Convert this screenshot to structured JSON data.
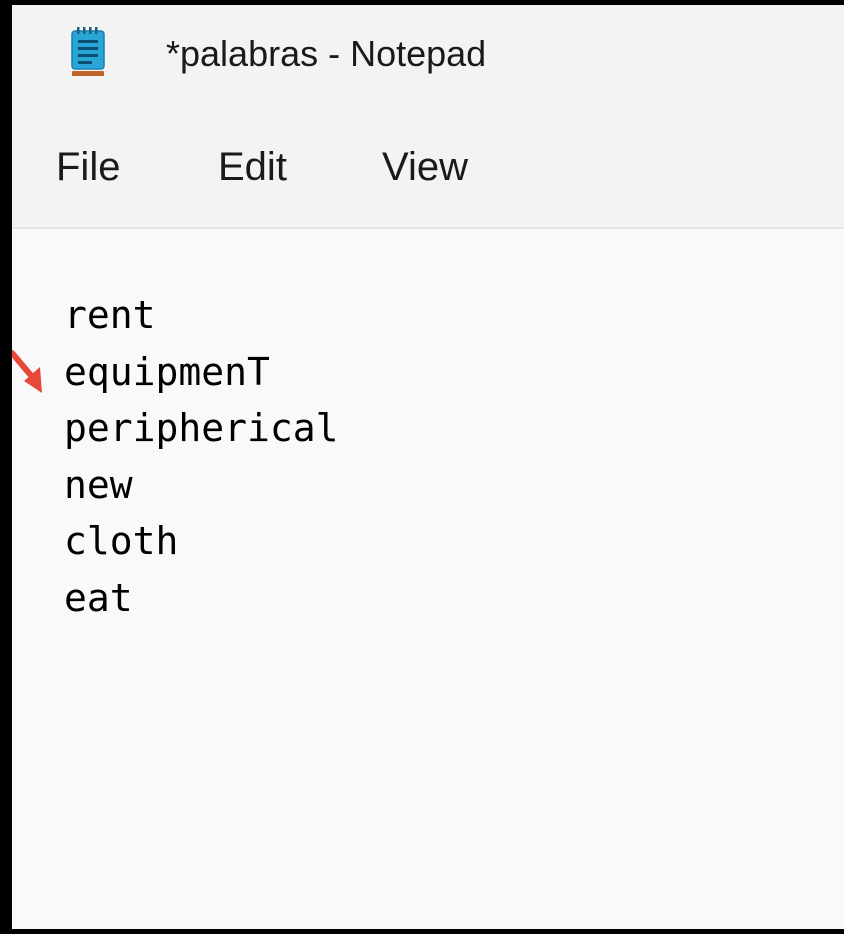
{
  "window": {
    "title": "*palabras - Notepad"
  },
  "menu": {
    "file": "File",
    "edit": "Edit",
    "view": "View"
  },
  "editor": {
    "lines": [
      "rent",
      "equipmenT",
      "peripherical",
      "new",
      "cloth",
      "eat"
    ]
  },
  "icons": {
    "app": "notepad-icon",
    "annotation": "red-arrow-icon"
  },
  "colors": {
    "annotation_arrow": "#e8483a",
    "icon_blue": "#2aa6d6",
    "icon_underline": "#c0642a"
  }
}
